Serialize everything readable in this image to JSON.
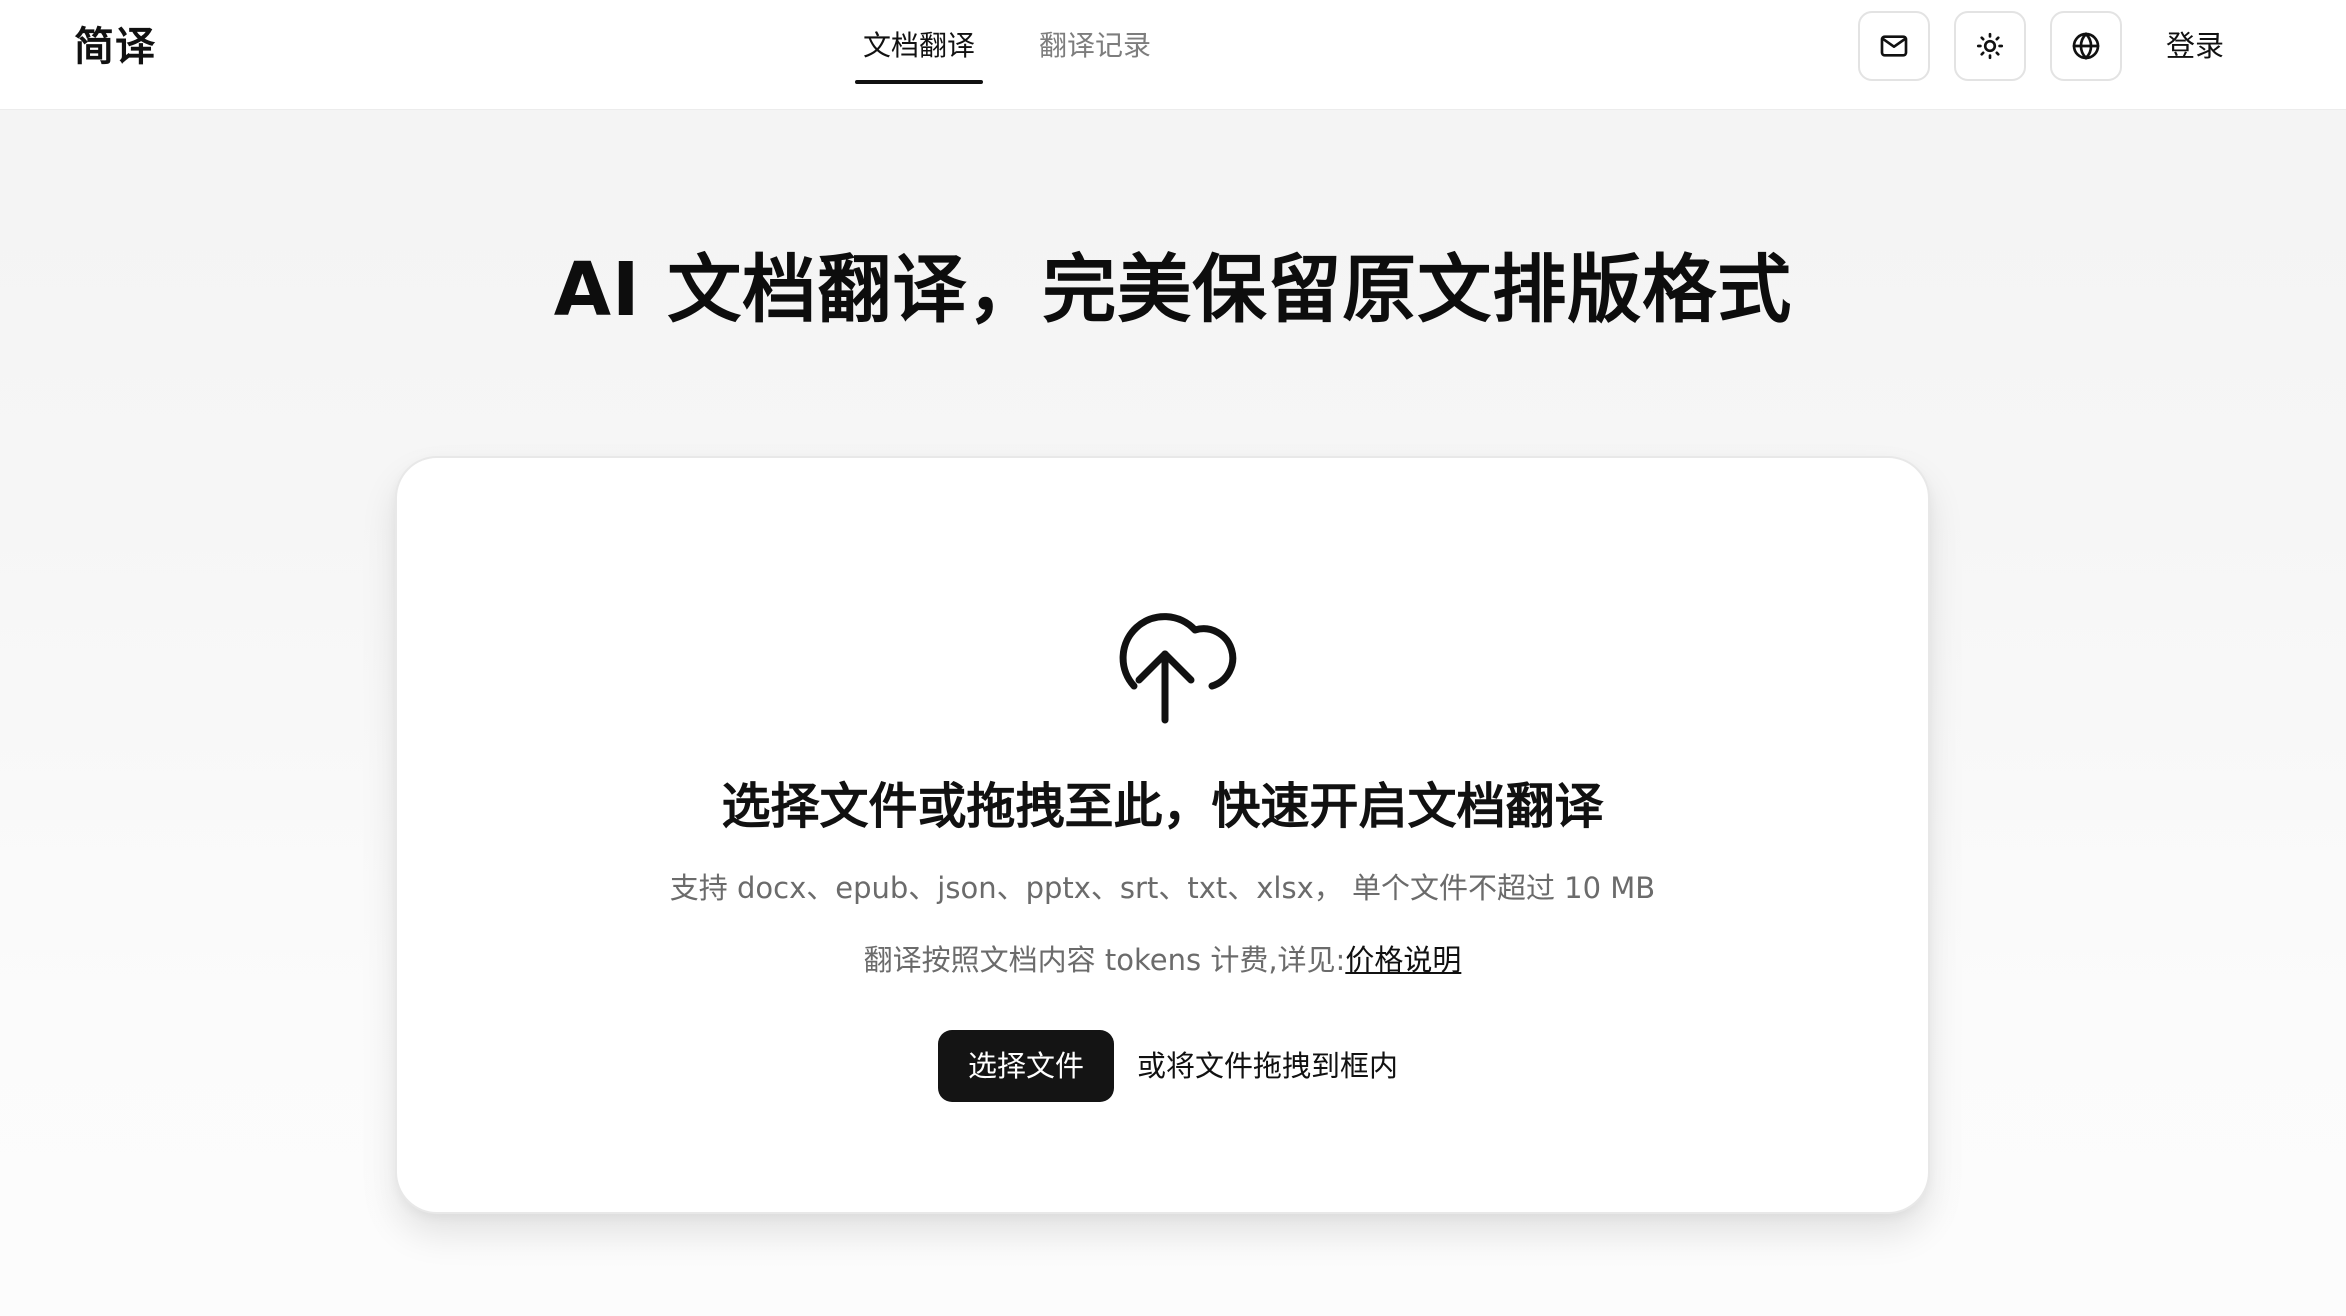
{
  "app": {
    "logo": "简译"
  },
  "nav": {
    "tabs": [
      {
        "label": "文档翻译",
        "active": true
      },
      {
        "label": "翻译记录",
        "active": false
      }
    ]
  },
  "header": {
    "icons": [
      "mail-icon",
      "sun-icon",
      "globe-icon"
    ],
    "login_label": "登录"
  },
  "hero": {
    "title": "AI 文档翻译，完美保留原文排版格式"
  },
  "upload": {
    "icon": "cloud-upload-icon",
    "title": "选择文件或拖拽至此，快速开启文档翻译",
    "support_text": "支持 docx、epub、json、pptx、srt、txt、xlsx， 单个文件不超过 10 MB",
    "pricing_prefix": "翻译按照文档内容 tokens 计费,详见:",
    "pricing_link": "价格说明",
    "select_button": "选择文件",
    "drop_hint": "或将文件拖拽到框内"
  },
  "colors": {
    "primary_button": "#141414",
    "muted_text": "#6b6b6b",
    "inactive_tab": "#7d7d7d"
  }
}
